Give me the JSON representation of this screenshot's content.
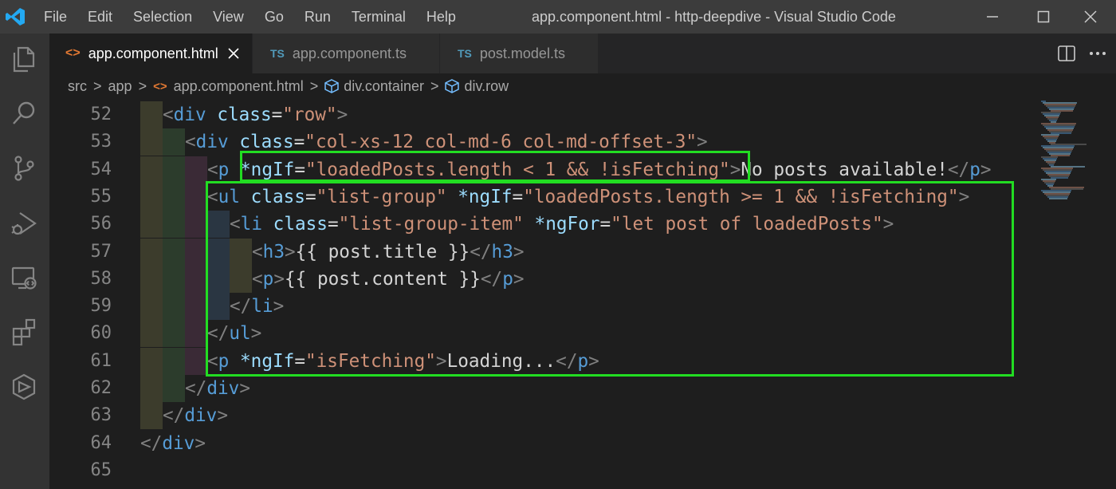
{
  "window": {
    "menu": [
      "File",
      "Edit",
      "Selection",
      "View",
      "Go",
      "Run",
      "Terminal",
      "Help"
    ],
    "title": "app.component.html - http-deepdive - Visual Studio Code",
    "accent": "#0078d4"
  },
  "activity_bar": [
    "explorer-icon",
    "search-icon",
    "source-control-icon",
    "run-debug-icon",
    "remote-explorer-icon",
    "extensions-icon",
    "angular-icon"
  ],
  "tabs": [
    {
      "label": "app.component.html",
      "icon": "<>",
      "icon_color": "#e37933"
    },
    {
      "label": "app.component.ts",
      "icon": "TS",
      "icon_color": "#519aba"
    },
    {
      "label": "post.model.ts",
      "icon": "TS",
      "icon_color": "#519aba"
    }
  ],
  "breadcrumb": [
    "src",
    "app",
    "app.component.html",
    "div.container",
    "div.row"
  ],
  "breadcrumb_sep": ">",
  "colors": {
    "tag": "#569cd6",
    "attr": "#9cdcfe",
    "string": "#ce9178",
    "punct": "#808080",
    "text": "#d4d4d4",
    "highlight_box": "#22dd22"
  },
  "code_lines": [
    {
      "n": "52",
      "indent": 1,
      "tokens": [
        [
          "p",
          "<"
        ],
        [
          "tag",
          "div"
        ],
        [
          "t",
          " "
        ],
        [
          "attr",
          "class"
        ],
        [
          "t",
          "="
        ],
        [
          "str",
          "\"row\""
        ],
        [
          "p",
          ">"
        ]
      ]
    },
    {
      "n": "53",
      "indent": 2,
      "tokens": [
        [
          "p",
          "<"
        ],
        [
          "tag",
          "div"
        ],
        [
          "t",
          " "
        ],
        [
          "attr",
          "class"
        ],
        [
          "t",
          "="
        ],
        [
          "str",
          "\"col-xs-12 col-md-6 col-md-offset-3\""
        ],
        [
          "p",
          ">"
        ]
      ]
    },
    {
      "n": "54",
      "indent": 3,
      "tokens": [
        [
          "p",
          "<"
        ],
        [
          "tag",
          "p"
        ],
        [
          "t",
          " "
        ],
        [
          "attr",
          "*ngIf"
        ],
        [
          "t",
          "="
        ],
        [
          "str",
          "\"loadedPosts.length < 1 && !isFetching\""
        ],
        [
          "p",
          ">"
        ],
        [
          "t",
          "No posts available!"
        ],
        [
          "p",
          "</"
        ],
        [
          "tag",
          "p"
        ],
        [
          "p",
          ">"
        ]
      ]
    },
    {
      "n": "55",
      "indent": 3,
      "tokens": [
        [
          "p",
          "<"
        ],
        [
          "tag",
          "ul"
        ],
        [
          "t",
          " "
        ],
        [
          "attr",
          "class"
        ],
        [
          "t",
          "="
        ],
        [
          "str",
          "\"list-group\""
        ],
        [
          "t",
          " "
        ],
        [
          "attr",
          "*ngIf"
        ],
        [
          "t",
          "="
        ],
        [
          "str",
          "\"loadedPosts.length >= 1 && !isFetching\""
        ],
        [
          "p",
          ">"
        ]
      ]
    },
    {
      "n": "56",
      "indent": 4,
      "tokens": [
        [
          "p",
          "<"
        ],
        [
          "tag",
          "li"
        ],
        [
          "t",
          " "
        ],
        [
          "attr",
          "class"
        ],
        [
          "t",
          "="
        ],
        [
          "str",
          "\"list-group-item\""
        ],
        [
          "t",
          " "
        ],
        [
          "attr",
          "*ngFor"
        ],
        [
          "t",
          "="
        ],
        [
          "str",
          "\"let post of loadedPosts\""
        ],
        [
          "p",
          ">"
        ]
      ]
    },
    {
      "n": "57",
      "indent": 5,
      "tokens": [
        [
          "p",
          "<"
        ],
        [
          "tag",
          "h3"
        ],
        [
          "p",
          ">"
        ],
        [
          "t",
          "{{ post.title }}"
        ],
        [
          "p",
          "</"
        ],
        [
          "tag",
          "h3"
        ],
        [
          "p",
          ">"
        ]
      ]
    },
    {
      "n": "58",
      "indent": 5,
      "tokens": [
        [
          "p",
          "<"
        ],
        [
          "tag",
          "p"
        ],
        [
          "p",
          ">"
        ],
        [
          "t",
          "{{ post.content }}"
        ],
        [
          "p",
          "</"
        ],
        [
          "tag",
          "p"
        ],
        [
          "p",
          ">"
        ]
      ]
    },
    {
      "n": "59",
      "indent": 4,
      "tokens": [
        [
          "p",
          "</"
        ],
        [
          "tag",
          "li"
        ],
        [
          "p",
          ">"
        ]
      ]
    },
    {
      "n": "60",
      "indent": 3,
      "tokens": [
        [
          "p",
          "</"
        ],
        [
          "tag",
          "ul"
        ],
        [
          "p",
          ">"
        ]
      ]
    },
    {
      "n": "61",
      "indent": 3,
      "tokens": [
        [
          "p",
          "<"
        ],
        [
          "tag",
          "p"
        ],
        [
          "t",
          " "
        ],
        [
          "attr",
          "*ngIf"
        ],
        [
          "t",
          "="
        ],
        [
          "str",
          "\"isFetching\""
        ],
        [
          "p",
          ">"
        ],
        [
          "t",
          "Loading..."
        ],
        [
          "p",
          "</"
        ],
        [
          "tag",
          "p"
        ],
        [
          "p",
          ">"
        ]
      ]
    },
    {
      "n": "62",
      "indent": 2,
      "tokens": [
        [
          "p",
          "</"
        ],
        [
          "tag",
          "div"
        ],
        [
          "p",
          ">"
        ]
      ]
    },
    {
      "n": "63",
      "indent": 1,
      "tokens": [
        [
          "p",
          "</"
        ],
        [
          "tag",
          "div"
        ],
        [
          "p",
          ">"
        ]
      ]
    },
    {
      "n": "64",
      "indent": 0,
      "tokens": [
        [
          "p",
          "</"
        ],
        [
          "tag",
          "div"
        ],
        [
          "p",
          ">"
        ]
      ]
    },
    {
      "n": "65",
      "indent": 0,
      "tokens": []
    }
  ]
}
